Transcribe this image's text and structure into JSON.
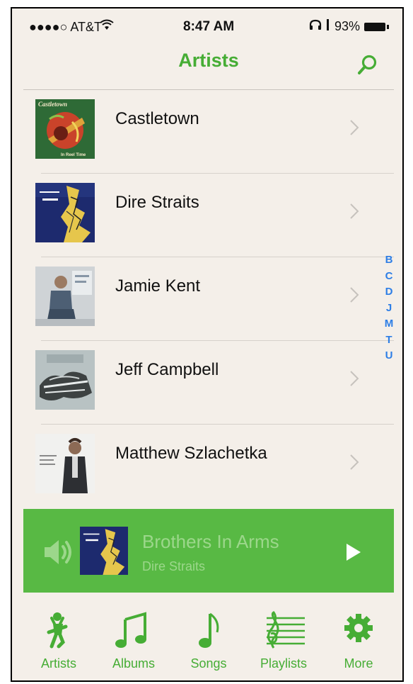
{
  "status": {
    "carrier": "●●●●○ AT&T",
    "time": "8:47 AM",
    "battery": "93%"
  },
  "nav": {
    "title": "Artists"
  },
  "artists": [
    {
      "name": "Castletown"
    },
    {
      "name": "Dire Straits"
    },
    {
      "name": "Jamie Kent"
    },
    {
      "name": "Jeff Campbell"
    },
    {
      "name": "Matthew Szlachetka"
    }
  ],
  "album_art_text": {
    "castletown_top": "Castletown",
    "castletown_bottom": "In Reel Time"
  },
  "index": [
    "B",
    "C",
    "D",
    "J",
    "M",
    "T",
    "U"
  ],
  "now_playing": {
    "title": "Brothers In Arms",
    "artist": "Dire Straits"
  },
  "tabs": [
    {
      "label": "Artists",
      "icon": "guitarist-icon"
    },
    {
      "label": "Albums",
      "icon": "music-notes-icon"
    },
    {
      "label": "Songs",
      "icon": "music-note-icon"
    },
    {
      "label": "Playlists",
      "icon": "staff-icon"
    },
    {
      "label": "More",
      "icon": "gear-icon"
    }
  ],
  "colors": {
    "accent": "#46ad35",
    "nowplaying_bg": "#58b944",
    "index": "#2d7ee6",
    "background": "#f4efe9"
  }
}
